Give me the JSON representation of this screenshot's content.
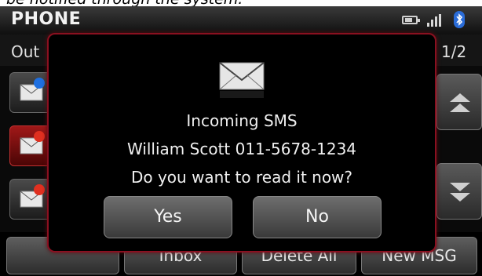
{
  "caption_fragment": "be notified through the system.",
  "status_bar": {
    "title": "PHONE"
  },
  "sub_header": {
    "tab_label": "Out",
    "page_indicator": "1/2"
  },
  "message_list": [
    {
      "badge_color": "#1e6fe0",
      "selected": false
    },
    {
      "badge_color": "#e03020",
      "selected": true
    },
    {
      "badge_color": "#e03020",
      "selected": false
    }
  ],
  "bottom_bar": {
    "buttons": [
      {
        "label": ""
      },
      {
        "label": "Inbox"
      },
      {
        "label": "Delete All"
      },
      {
        "label": "New MSG"
      }
    ]
  },
  "popup": {
    "icon": "envelope-icon",
    "title": "Incoming SMS",
    "sender_line": "William Scott 011-5678-1234",
    "question": "Do you want to read it now?",
    "yes_label": "Yes",
    "no_label": "No"
  },
  "colors": {
    "accent_red": "#8a1020",
    "bluetooth": "#2a6cd8"
  }
}
